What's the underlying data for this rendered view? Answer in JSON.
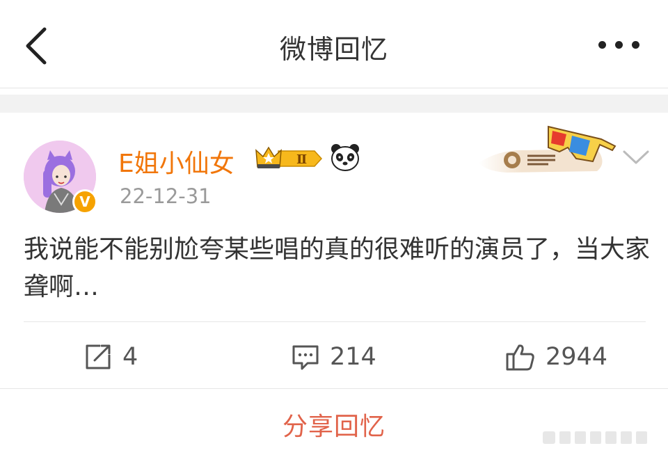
{
  "header": {
    "title": "微博回忆",
    "back_icon": "chevron-left-icon",
    "more_icon": "ellipsis-icon"
  },
  "post": {
    "author_name": "E姐小仙女",
    "member_level": "Ⅱ",
    "verified_badge": "V",
    "date": "22-12-31",
    "content": "我说能不能别尬夸某些唱的真的很难听的演员了，当大家聋啊…",
    "repost_count": "4",
    "comment_count": "214",
    "like_count": "2944"
  },
  "footer": {
    "share_label": "分享回忆"
  },
  "colors": {
    "name_orange": "#f1760a",
    "share_red": "#e1634a",
    "gray_text": "#9a9a9a",
    "verified_gold": "#f6a200"
  }
}
